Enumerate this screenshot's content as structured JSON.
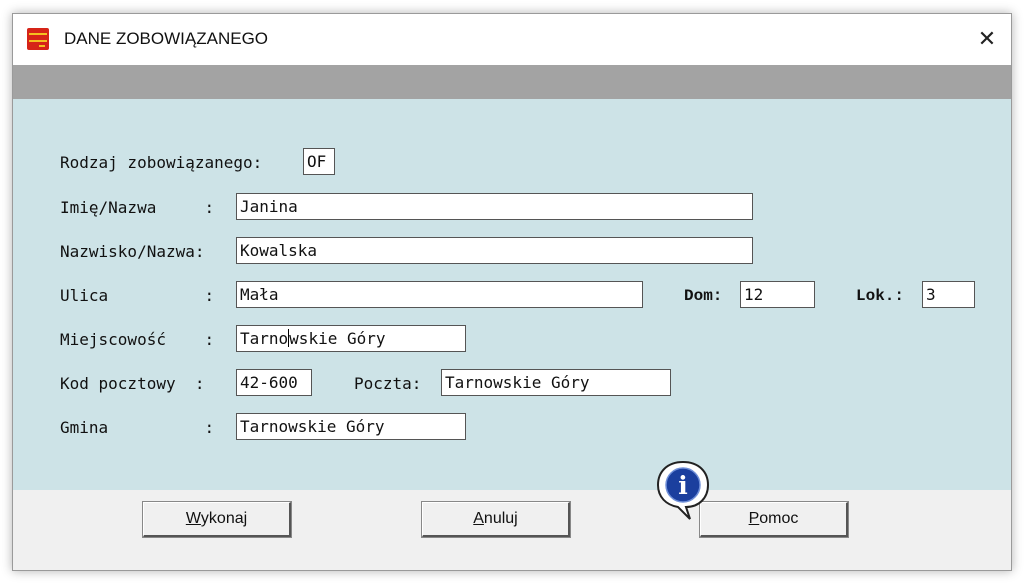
{
  "window": {
    "title": "DANE ZOBOWIĄZANEGO",
    "close_symbol": "✕"
  },
  "form": {
    "rodzaj": {
      "label": "Rodzaj zobowiązanego:",
      "value": "OF"
    },
    "imie": {
      "label": "Imię/Nazwa     :",
      "value": "Janina"
    },
    "nazwisko": {
      "label": "Nazwisko/Nazwa:",
      "value": "Kowalska"
    },
    "ulica": {
      "label": "Ulica          :",
      "value": "Mała"
    },
    "dom": {
      "label": "Dom:",
      "value": "12"
    },
    "lok": {
      "label": "Lok.:",
      "value": "3"
    },
    "miejscowosc": {
      "label": "Miejscowość    :",
      "value_before_caret": "Tarno",
      "value_after_caret": "wskie Góry"
    },
    "kod": {
      "label": "Kod pocztowy  :",
      "value": "42-600"
    },
    "poczta": {
      "label": "Poczta:",
      "value": "Tarnowskie Góry"
    },
    "gmina": {
      "label": "Gmina          :",
      "value": "Tarnowskie Góry"
    }
  },
  "buttons": {
    "wykonaj": {
      "mnemonic": "W",
      "rest": "ykonaj"
    },
    "anuluj": {
      "mnemonic": "A",
      "rest": "nuluj"
    },
    "pomoc": {
      "mnemonic": "P",
      "rest": "omoc"
    }
  },
  "help_icon": {
    "name": "info-icon",
    "glyph": "i"
  },
  "colors": {
    "panel": "#cde3e7",
    "graybar": "#a3a3a3",
    "button_area": "#f0f0f0",
    "info_blue": "#1b3f9e"
  }
}
